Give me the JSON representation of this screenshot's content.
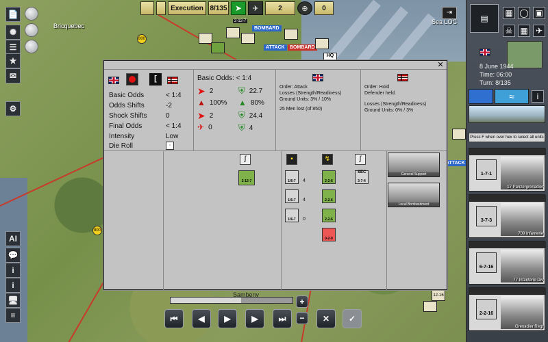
{
  "topbar": {
    "phase": "Execution",
    "turn": "8/135",
    "count_a": "2",
    "count_b": "0",
    "unit_tag": "2-12-7"
  },
  "map": {
    "place": "Bricquebec",
    "sea_loc": "Sea LOC",
    "hex_800": "800",
    "tag_bombard": "BOMBARD",
    "tag_attack": "ATTACK",
    "tag_hq": "HQ",
    "bottom_label": "Sambeny",
    "hex_num_1": "12-16",
    "attack_tag2": "ATTACK"
  },
  "side_panel": {
    "date": "8 June 1944",
    "time": "Time: 06:00",
    "turn": "Turn: 8/135",
    "hint": "Press F when over hex to select all units",
    "units": [
      {
        "name": "17 Panzergrenadier",
        "strength": "1-7-1"
      },
      {
        "name": "709 Infanterie",
        "strength": "3-7-3"
      },
      {
        "name": "77 Infanterie Div",
        "strength": "6-7-16"
      },
      {
        "name": "Grenadier Regt",
        "strength": "2-2-16"
      }
    ]
  },
  "dialog": {
    "labels": {
      "basic_odds": "Basic Odds",
      "odds_shifts": "Odds Shifts",
      "shock_shifts": "Shock Shifts",
      "final_odds": "Final Odds",
      "intensity": "Intensity",
      "die_roll": "Die Roll"
    },
    "values": {
      "basic_odds": "< 1:4",
      "odds_shifts": "-2",
      "shock_shifts": "0",
      "final_odds": "< 1:4",
      "intensity": "Low"
    },
    "odds_header": "Basic Odds: < 1:4",
    "attacker_stats": [
      "2",
      "100%",
      "2",
      "0"
    ],
    "defender_stats": [
      "22.7",
      "80%",
      "24.4",
      "4"
    ],
    "attacker": {
      "order": "Order: Attack",
      "losses_title": "Losses (Strength/Readiness)",
      "ground_units": "Ground Units: 3% / 10%",
      "men_lost": "25 Men lost (of 850)"
    },
    "defender": {
      "order": "Order: Hold",
      "result": "Defender held.",
      "losses_title": "Losses (Strength/Readiness)",
      "ground_units": "Ground Units: 0% / 3%"
    },
    "attacker_unit": "2-12-7",
    "defender_units": [
      {
        "label": "1/6-7",
        "count": "4"
      },
      {
        "label": "1/6-7",
        "count": "4"
      },
      {
        "label": "1/6-7",
        "count": "0"
      }
    ],
    "defender_units_2": [
      {
        "label": "2-2-6"
      },
      {
        "label": "2-2-6"
      },
      {
        "label": "2-2-6"
      },
      {
        "label": "0-2-0"
      }
    ],
    "sec_label": "SEC",
    "sec_value": "3-7-4",
    "photo1_caption": "General Support",
    "photo2_caption": "Local Bombardment"
  },
  "bottom": {
    "progress": 0.58
  },
  "icons": {
    "close": "close-icon",
    "flag_uk": "uk-flag-icon",
    "flag_de": "german-flag-icon"
  }
}
